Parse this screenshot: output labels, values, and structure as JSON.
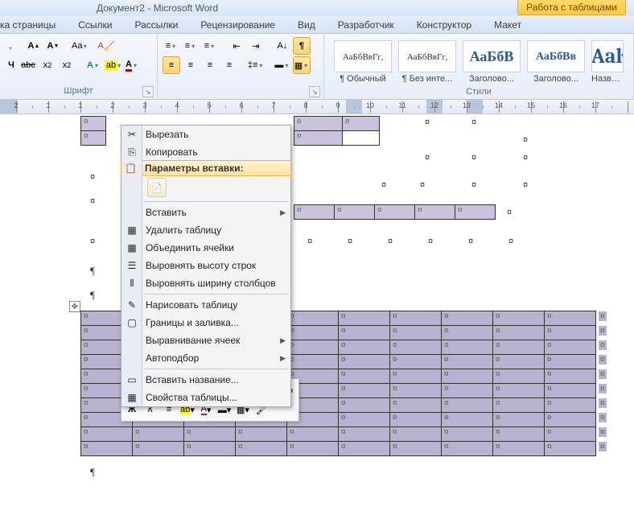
{
  "title": "Документ2 - Microsoft Word",
  "tabtools": "Работа с таблицами",
  "tabs": [
    "ка страницы",
    "Ссылки",
    "Рассылки",
    "Рецензирование",
    "Вид",
    "Разработчик",
    "Конструктор",
    "Макет"
  ],
  "ribbon_groups": {
    "font": "Шрифт",
    "para": "",
    "styles": "Стили"
  },
  "styles": [
    {
      "preview": "АаБбВвГг,",
      "label": "¶ Обычный"
    },
    {
      "preview": "АаБбВвГг,",
      "label": "¶ Без инте..."
    },
    {
      "preview": "АаБбВ",
      "label": "Заголово..."
    },
    {
      "preview": "АаБбВв",
      "label": "Заголово..."
    },
    {
      "preview": "Aaŀ",
      "label": "Названи"
    }
  ],
  "ruler_numbers": [
    2,
    1,
    1,
    2,
    3,
    4,
    5,
    6,
    7,
    8,
    9,
    10,
    11,
    12,
    13,
    14,
    15,
    16,
    17
  ],
  "context_menu": {
    "cut": "Вырезать",
    "copy": "Копировать",
    "paste_hdr": "Параметры вставки:",
    "insert": "Вставить",
    "del_table": "Удалить таблицу",
    "merge": "Объединить ячейки",
    "dist_rows": "Выровнять высоту строк",
    "dist_cols": "Выровнять ширину столбцов",
    "draw": "Нарисовать таблицу",
    "borders": "Границы и заливка...",
    "align": "Выравнивание ячеек",
    "autofit": "Автоподбор",
    "caption": "Вставить название...",
    "props": "Свойства таблицы..."
  },
  "mini": {
    "bold": "Ж",
    "italic": "К"
  },
  "cell_mark": "¤",
  "para": "¶",
  "chart_data": null
}
